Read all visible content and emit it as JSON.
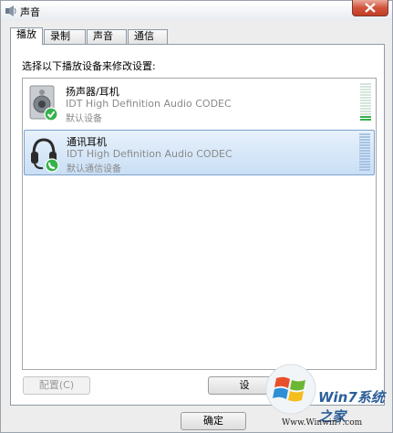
{
  "window": {
    "title": "声音"
  },
  "tabs": [
    {
      "label": "播放"
    },
    {
      "label": "录制"
    },
    {
      "label": "声音"
    },
    {
      "label": "通信"
    }
  ],
  "instruction": "选择以下播放设备来修改设置:",
  "devices": [
    {
      "name": "扬声器/耳机",
      "driver": "IDT High Definition Audio CODEC",
      "status": "默认设备",
      "icon": "speaker-icon",
      "badge": "default-check-icon",
      "level": 0.1
    },
    {
      "name": "通讯耳机",
      "driver": "IDT High Definition Audio CODEC",
      "status": "默认通信设备",
      "icon": "headset-icon",
      "badge": "communication-phone-icon",
      "level": 0
    }
  ],
  "buttons": {
    "configure": "配置(C)",
    "set_default": "设",
    "ok": "确定"
  },
  "watermark": {
    "brand": "Win7系统之家",
    "url": "Www.Winwin7.com"
  },
  "colors": {
    "accent_green": "#36b24a",
    "selection": "#c9dff5",
    "close_red": "#d2533c",
    "watermark_blue": "#2d5f9a"
  }
}
